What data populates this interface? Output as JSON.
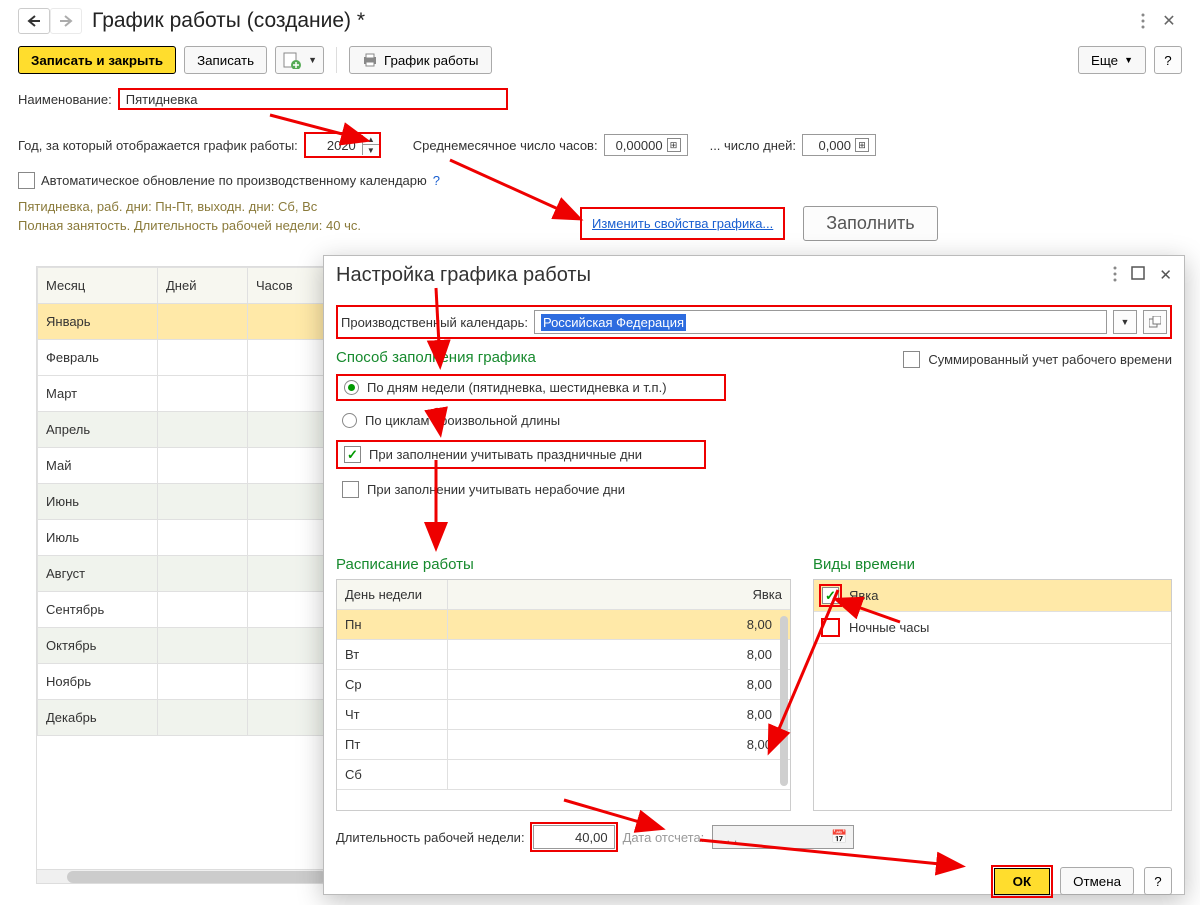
{
  "header": {
    "title": "График работы (создание) *"
  },
  "toolbar": {
    "save_close": "Записать и закрыть",
    "save": "Записать",
    "print": "График работы",
    "more": "Еще",
    "help": "?"
  },
  "fields": {
    "name_label": "Наименование:",
    "name_value": "Пятидневка",
    "year_label": "Год, за который отображается график работы:",
    "year_value": "2020",
    "avg_hours_label": "Среднемесячное число часов:",
    "avg_hours_value": "0,00000",
    "avg_days_label": "... число дней:",
    "avg_days_value": "0,000",
    "auto_update_label": "Автоматическое обновление по производственному календарю",
    "auto_update_help": "?",
    "summary_line1": "Пятидневка, раб. дни: Пн-Пт, выходн. дни: Сб, Вс",
    "summary_line2": "Полная занятость. Длительность рабочей недели: 40 чс.",
    "change_props_link": "Изменить свойства графика...",
    "fill_button": "Заполнить"
  },
  "month_table": {
    "headers": [
      "Месяц",
      "Дней",
      "Часов"
    ],
    "rows": [
      {
        "m": "Январь",
        "sel": true
      },
      {
        "m": "Февраль"
      },
      {
        "m": "Март"
      },
      {
        "m": "Апрель",
        "alt": true
      },
      {
        "m": "Май"
      },
      {
        "m": "Июнь",
        "alt": true
      },
      {
        "m": "Июль"
      },
      {
        "m": "Август",
        "alt": true
      },
      {
        "m": "Сентябрь"
      },
      {
        "m": "Октябрь",
        "alt": true
      },
      {
        "m": "Ноябрь"
      },
      {
        "m": "Декабрь",
        "alt": true
      }
    ]
  },
  "modal": {
    "title": "Настройка графика работы",
    "calendar_label": "Производственный календарь:",
    "calendar_value": "Российская Федерация",
    "fill_method_heading": "Способ заполнения графика",
    "sum_accounting_label": "Суммированный учет рабочего времени",
    "opt_weekdays": "По дням недели (пятидневка, шестидневка и т.п.)",
    "opt_cycles": "По циклам произвольной длины",
    "opt_holidays": "При заполнении учитывать праздничные дни",
    "opt_nonwork": "При заполнении учитывать нерабочие дни",
    "sched_heading": "Расписание работы",
    "sched_headers": [
      "День недели",
      "Явка"
    ],
    "sched_rows": [
      {
        "d": "Пн",
        "v": "8,00",
        "sel": true
      },
      {
        "d": "Вт",
        "v": "8,00"
      },
      {
        "d": "Ср",
        "v": "8,00"
      },
      {
        "d": "Чт",
        "v": "8,00"
      },
      {
        "d": "Пт",
        "v": "8,00"
      },
      {
        "d": "Сб",
        "v": ""
      }
    ],
    "types_heading": "Виды времени",
    "types_rows": [
      {
        "label": "Явка",
        "checked": true
      },
      {
        "label": "Ночные часы",
        "checked": false
      }
    ],
    "week_len_label": "Длительность рабочей недели:",
    "week_len_value": "40,00",
    "ref_date_label": "Дата отсчета:",
    "ref_date_value": ". . .",
    "ok": "ОК",
    "cancel": "Отмена",
    "help": "?"
  }
}
